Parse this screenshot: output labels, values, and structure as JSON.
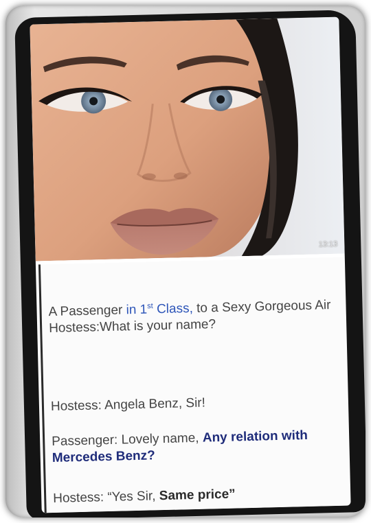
{
  "photo": {
    "timestamp": "13:13"
  },
  "post": {
    "line1": {
      "a": "A Passenger ",
      "b": "in 1",
      "sup": "st",
      "c": " Class,",
      "d": " to a Sexy Gorgeous Air Hostess:",
      "e": "What is your name?"
    },
    "line2": {
      "speaker": "Hostess: ",
      "text": "Angela Benz, Sir!"
    },
    "line3": {
      "speaker": "Passenger: Lovely name, ",
      "emph": "Any relation with Mercedes Benz?"
    },
    "line4": {
      "speaker": "Hostess: ",
      "quote_open": "“Yes Sir, ",
      "emph": "Same price”"
    }
  },
  "colors": {
    "link_blue": "#2d55b8",
    "navy": "#1f2c7a",
    "device": "#141414"
  }
}
